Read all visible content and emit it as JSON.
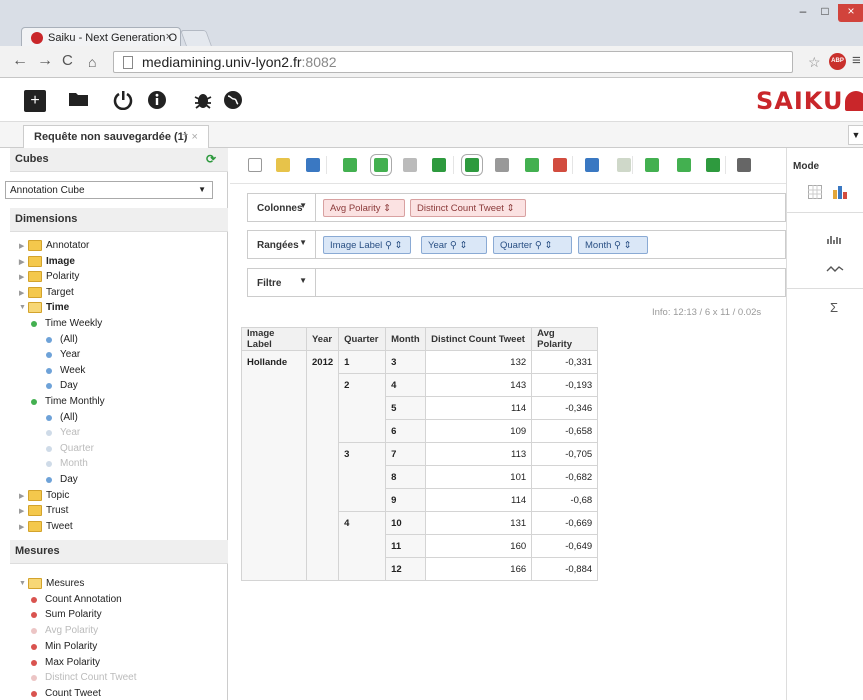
{
  "browser": {
    "tab_title": "Saiku - Next Generation O",
    "tab_close": "×",
    "url_main": "mediamining.univ-lyon2.fr",
    "url_port": ":8082",
    "nav": {
      "back": "←",
      "forward": "→",
      "reload": "C",
      "home": "⌂"
    },
    "star": "☆",
    "abp": "ABP",
    "menu": "≡",
    "window": {
      "min": "–",
      "max": "□",
      "close": "×"
    }
  },
  "app": {
    "logo": "SAIKU",
    "header_icons": [
      {
        "name": "new-query-icon",
        "glyph": "+"
      },
      {
        "name": "open-query-icon",
        "glyph": "▰"
      },
      {
        "name": "logout-icon",
        "glyph": "⏻"
      },
      {
        "name": "about-icon",
        "glyph": "ℹ"
      },
      {
        "name": "bug-report-icon",
        "glyph": "✱"
      },
      {
        "name": "globe-icon",
        "glyph": "◍"
      }
    ]
  },
  "query_tabs": {
    "active": "Requête non sauvegardée (1)",
    "close": "×",
    "add": "+"
  },
  "left_panel": {
    "cubes_title": "Cubes",
    "cube_selected": "Annotation Cube",
    "dimensions_title": "Dimensions",
    "dimensions": [
      {
        "label": "Annotator",
        "type": "folder"
      },
      {
        "label": "Image",
        "type": "folder",
        "bold": true
      },
      {
        "label": "Polarity",
        "type": "folder"
      },
      {
        "label": "Target",
        "type": "folder"
      },
      {
        "label": "Time",
        "type": "folder-open",
        "bold": true
      },
      {
        "label": "Time Weekly",
        "type": "hier"
      },
      {
        "label": "(All)",
        "type": "level"
      },
      {
        "label": "Year",
        "type": "level"
      },
      {
        "label": "Week",
        "type": "level"
      },
      {
        "label": "Day",
        "type": "level"
      },
      {
        "label": "Time Monthly",
        "type": "hier"
      },
      {
        "label": "(All)",
        "type": "level"
      },
      {
        "label": "Year",
        "type": "level-disabled"
      },
      {
        "label": "Quarter",
        "type": "level-disabled"
      },
      {
        "label": "Month",
        "type": "level-disabled"
      },
      {
        "label": "Day",
        "type": "level"
      },
      {
        "label": "Topic",
        "type": "folder"
      },
      {
        "label": "Trust",
        "type": "folder"
      },
      {
        "label": "Tweet",
        "type": "folder"
      }
    ],
    "measures_title": "Mesures",
    "measures_group": "Mesures",
    "measures": [
      {
        "label": "Count Annotation",
        "disabled": false
      },
      {
        "label": "Sum Polarity",
        "disabled": false
      },
      {
        "label": "Avg Polarity",
        "disabled": true
      },
      {
        "label": "Min Polarity",
        "disabled": false
      },
      {
        "label": "Max Polarity",
        "disabled": false
      },
      {
        "label": "Distinct Count Tweet",
        "disabled": true
      },
      {
        "label": "Count Tweet",
        "disabled": false
      }
    ]
  },
  "toolbar_icons": [
    {
      "name": "new-icon",
      "color": "#ffffff"
    },
    {
      "name": "open-icon",
      "color": "#e7c34a"
    },
    {
      "name": "save-icon",
      "color": "#3a78c2"
    },
    {
      "name": "run-query-icon",
      "color": "#43b050"
    },
    {
      "name": "automatic-execution-icon",
      "color": "#43b050"
    },
    {
      "name": "toggle-fields-icon",
      "color": "#bbbbbb"
    },
    {
      "name": "non-empty-icon",
      "color": "#2e9a3e"
    },
    {
      "name": "swap-axis-icon",
      "color": "#2e9a3e"
    },
    {
      "name": "show-mdx-icon",
      "color": "#999999"
    },
    {
      "name": "drillthrough-icon",
      "color": "#43b050"
    },
    {
      "name": "mdx-icon",
      "color": "#d24c3f"
    },
    {
      "name": "explain-icon",
      "color": "#3a78c2"
    },
    {
      "name": "zoom-mode-icon",
      "color": "#cfd8c9"
    },
    {
      "name": "export-xls-icon",
      "color": "#43b050"
    },
    {
      "name": "export-csv-icon",
      "color": "#43b050"
    },
    {
      "name": "export-excel-icon",
      "color": "#2e9a3e"
    },
    {
      "name": "help-icon",
      "color": "#666666"
    }
  ],
  "zones": {
    "columns": {
      "label": "Colonnes",
      "chips": [
        "Avg Polarity",
        "Distinct Count Tweet"
      ]
    },
    "rows": {
      "label": "Rangées",
      "chips": [
        "Image Label",
        "Year",
        "Quarter",
        "Month"
      ]
    },
    "filter": {
      "label": "Filtre"
    }
  },
  "info": "Info:  12:13  /  6 x 11  /  0.02s",
  "table": {
    "headers": [
      "Image Label",
      "Year",
      "Quarter",
      "Month",
      "Distinct Count Tweet",
      "Avg Polarity"
    ],
    "image_label": "Hollande",
    "year": "2012",
    "quarters": [
      {
        "label": "1",
        "rows": [
          {
            "month": "3",
            "count": "132",
            "avg": "-0,331"
          }
        ]
      },
      {
        "label": "2",
        "rows": [
          {
            "month": "4",
            "count": "143",
            "avg": "-0,193"
          },
          {
            "month": "5",
            "count": "114",
            "avg": "-0,346"
          },
          {
            "month": "6",
            "count": "109",
            "avg": "-0,658"
          }
        ]
      },
      {
        "label": "3",
        "rows": [
          {
            "month": "7",
            "count": "113",
            "avg": "-0,705"
          },
          {
            "month": "8",
            "count": "101",
            "avg": "-0,682"
          },
          {
            "month": "9",
            "count": "114",
            "avg": "-0,68"
          }
        ]
      },
      {
        "label": "4",
        "rows": [
          {
            "month": "10",
            "count": "131",
            "avg": "-0,669"
          },
          {
            "month": "11",
            "count": "160",
            "avg": "-0,649"
          },
          {
            "month": "12",
            "count": "166",
            "avg": "-0,884"
          }
        ]
      }
    ]
  },
  "right_panel": {
    "mode_label": "Mode",
    "icons": [
      "table-mode-icon",
      "chart-mode-icon",
      "statistics-icon",
      "trend-icon",
      "sum-icon"
    ]
  }
}
